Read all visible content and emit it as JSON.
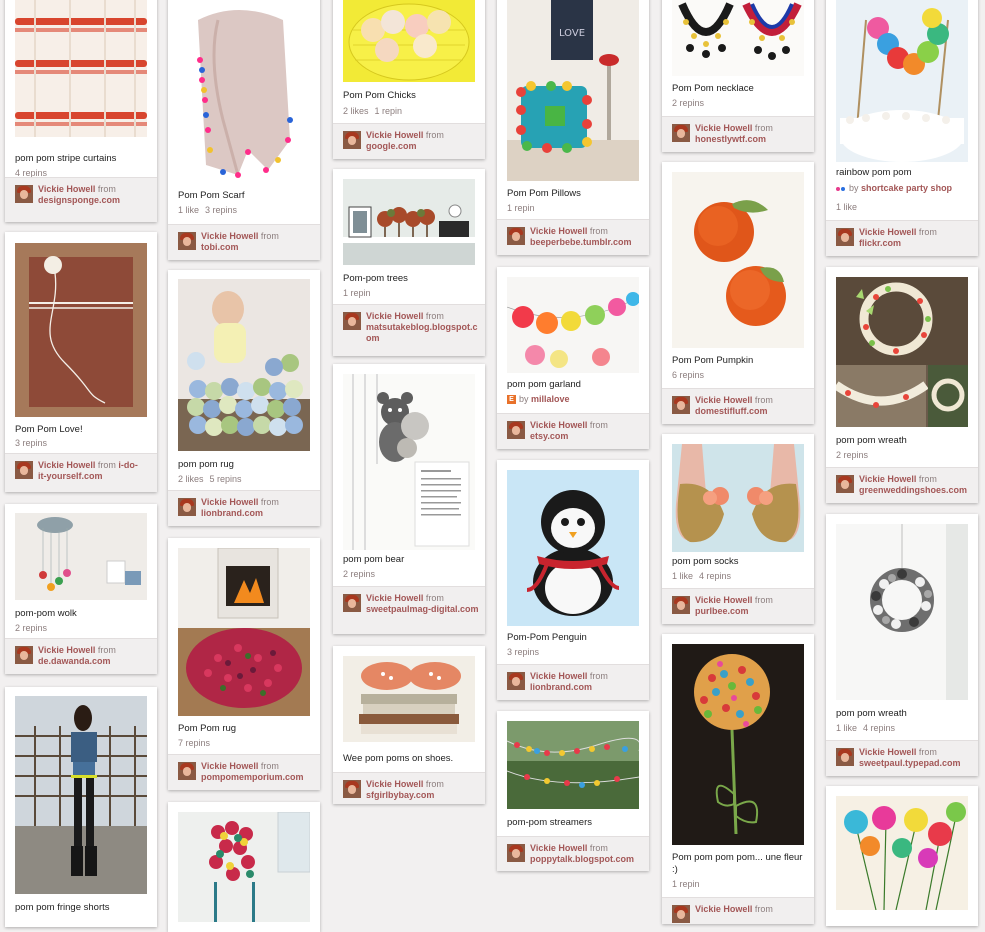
{
  "source_prefix": "from",
  "columns": [
    [
      {
        "desc": "pom pom stripe curtains",
        "stats": [
          "4 repins"
        ],
        "user": "Vickie Howell",
        "site_a": "",
        "site_b": "designsponge.com"
      },
      {
        "desc": "Pom Pom Love!",
        "stats": [
          "3 repins"
        ],
        "user": "Vickie Howell",
        "site_a": "i-do-",
        "site_b": "it-yourself.com"
      },
      {
        "desc": "pom-pom wolk",
        "stats": [
          "2 repins"
        ],
        "user": "Vickie Howell",
        "site_a": "",
        "site_b": "de.dawanda.com"
      },
      {
        "desc": "pom pom fringe shorts",
        "stats": [],
        "user": "",
        "site_a": "",
        "site_b": ""
      }
    ],
    [
      {
        "desc": "Pom Pom Scarf",
        "stats": [
          "1 like",
          "3 repins"
        ],
        "user": "Vickie Howell",
        "site_a": "",
        "site_b": "tobi.com"
      },
      {
        "desc": "pom pom rug",
        "stats": [
          "2 likes",
          "5 repins"
        ],
        "user": "Vickie Howell",
        "site_a": "",
        "site_b": "lionbrand.com"
      },
      {
        "desc": "Pom Pom rug",
        "stats": [
          "7 repins"
        ],
        "user": "Vickie Howell",
        "site_a": "",
        "site_b": "pompomemporium.com"
      },
      {
        "desc": "",
        "stats": [],
        "user": "",
        "site_a": "",
        "site_b": ""
      }
    ],
    [
      {
        "desc": "Pom Pom Chicks",
        "stats": [
          "2 likes",
          "1 repin"
        ],
        "user": "Vickie Howell",
        "site_a": "",
        "site_b": "google.com"
      },
      {
        "desc": "Pom-pom trees",
        "stats": [
          "1 repin"
        ],
        "user": "Vickie Howell",
        "site_a": "",
        "site_b": "matsutakeblog.blogspot.com"
      },
      {
        "desc": "pom pom bear",
        "stats": [
          "2 repins"
        ],
        "user": "Vickie Howell",
        "site_a": "",
        "site_b": "sweetpaulmag-digital.com"
      },
      {
        "desc": "Wee pom poms on shoes.",
        "stats": [],
        "user": "Vickie Howell",
        "site_a": "",
        "site_b": "sfgirlbybay.com"
      }
    ],
    [
      {
        "desc": "Pom Pom Pillows",
        "stats": [
          "1 repin"
        ],
        "user": "Vickie Howell",
        "site_a": "",
        "site_b": "beeperbebe.tumblr.com"
      },
      {
        "desc": "pom pom garland",
        "stats": [],
        "source_badge": "E",
        "source_text": "by",
        "source_name": "millalove",
        "user": "Vickie Howell",
        "site_a": "",
        "site_b": "etsy.com"
      },
      {
        "desc": "Pom-Pom Penguin",
        "stats": [
          "3 repins"
        ],
        "user": "Vickie Howell",
        "site_a": "",
        "site_b": "lionbrand.com"
      },
      {
        "desc": "pom-pom streamers",
        "stats": [],
        "user": "Vickie Howell",
        "site_a": "",
        "site_b": "poppytalk.blogspot.com"
      }
    ],
    [
      {
        "desc": "Pom Pom necklace",
        "stats": [
          "2 repins"
        ],
        "user": "Vickie Howell",
        "site_a": "",
        "site_b": "honestlywtf.com"
      },
      {
        "desc": "Pom Pom Pumpkin",
        "stats": [
          "6 repins"
        ],
        "user": "Vickie Howell",
        "site_a": "",
        "site_b": "domestifluff.com"
      },
      {
        "desc": "pom pom socks",
        "stats": [
          "1 like",
          "4 repins"
        ],
        "user": "Vickie Howell",
        "site_a": "",
        "site_b": "purlbee.com"
      },
      {
        "desc": "Pom pom pom pom... une fleur :)",
        "stats": [
          "1 repin"
        ],
        "user": "Vickie Howell",
        "site_a": "",
        "site_b": ""
      }
    ],
    [
      {
        "desc": "rainbow pom pom",
        "stats": [
          "1 like"
        ],
        "source_text": "by",
        "source_name": "shortcake party shop",
        "user": "Vickie Howell",
        "site_a": "",
        "site_b": "flickr.com"
      },
      {
        "desc": "pom pom wreath",
        "stats": [
          "2 repins"
        ],
        "user": "Vickie Howell",
        "site_a": "",
        "site_b": "greenweddingshoes.com"
      },
      {
        "desc": "pom pom wreath",
        "stats": [
          "1 like",
          "4 repins"
        ],
        "user": "Vickie Howell",
        "site_a": "",
        "site_b": "sweetpaul.typepad.com"
      },
      {
        "desc": "",
        "stats": [],
        "user": "",
        "site_a": "",
        "site_b": ""
      }
    ]
  ]
}
